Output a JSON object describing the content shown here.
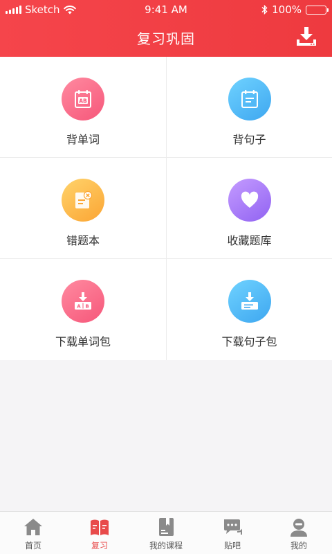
{
  "status_bar": {
    "carrier": "Sketch",
    "time": "9:41 AM",
    "battery": "100%"
  },
  "header": {
    "title": "复习巩固",
    "download_icon": "download-icon"
  },
  "grid": [
    {
      "label": "背单词",
      "icon": "word-card-icon",
      "color": "#f6577a"
    },
    {
      "label": "背句子",
      "icon": "sentence-card-icon",
      "color": "#3ea7f0"
    },
    {
      "label": "错题本",
      "icon": "mistake-notebook-icon",
      "color": "#fba534"
    },
    {
      "label": "收藏题库",
      "icon": "heart-icon",
      "color": "#9163f2"
    },
    {
      "label": "下载单词包",
      "icon": "download-words-icon",
      "color": "#f6577a"
    },
    {
      "label": "下载句子包",
      "icon": "download-sentences-icon",
      "color": "#3ea7f0"
    }
  ],
  "tabbar": [
    {
      "label": "首页",
      "icon": "home-icon",
      "active": false
    },
    {
      "label": "复习",
      "icon": "review-book-icon",
      "active": true
    },
    {
      "label": "我的课程",
      "icon": "course-icon",
      "active": false
    },
    {
      "label": "贴吧",
      "icon": "chat-icon",
      "active": false
    },
    {
      "label": "我的",
      "icon": "profile-icon",
      "active": false
    }
  ],
  "colors": {
    "header": "#ee3a3f",
    "active_tab": "#e84a4a",
    "tab_icon": "#8a8a8a"
  }
}
